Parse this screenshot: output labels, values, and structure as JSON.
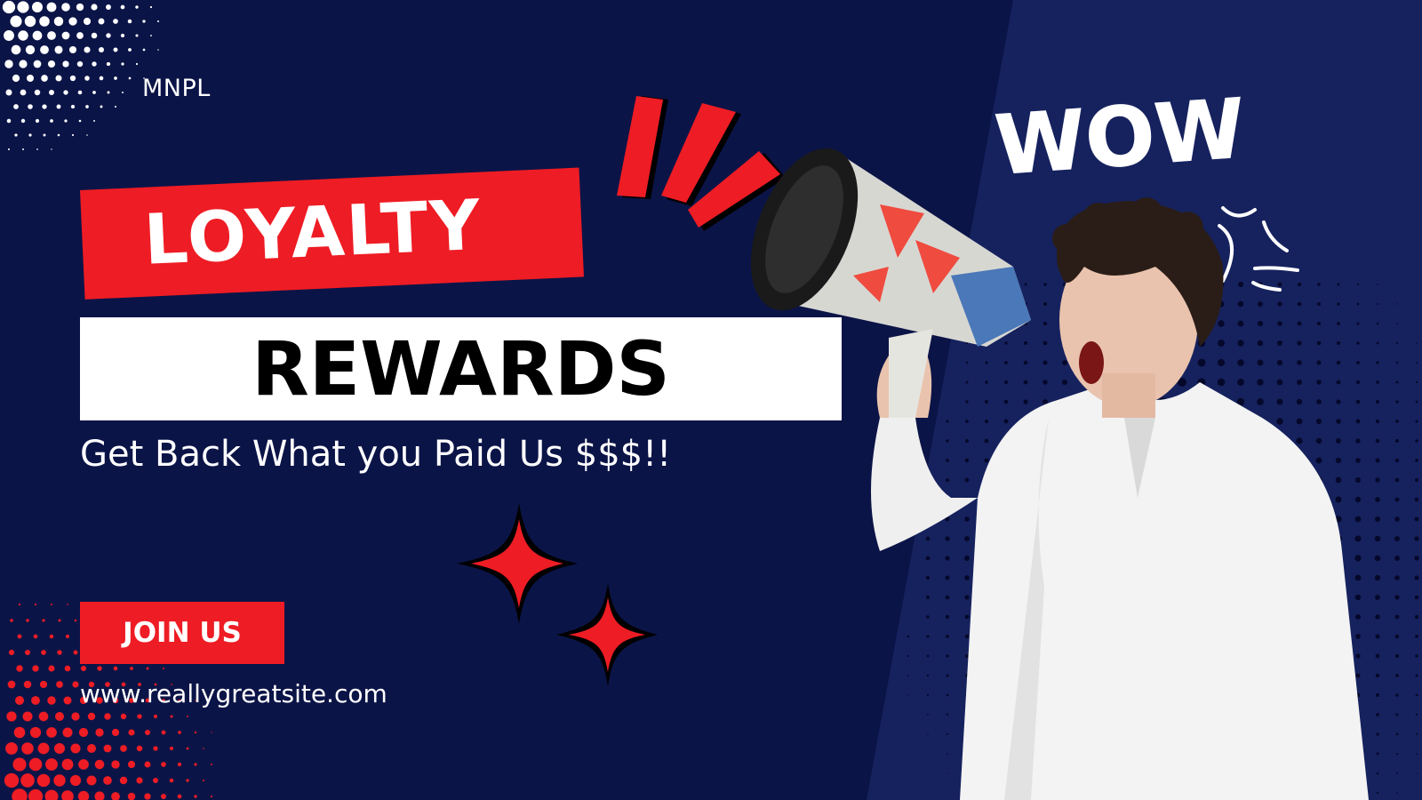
{
  "brand": {
    "name": "MNPL"
  },
  "headline": {
    "line1": "LOYALTY",
    "line2": "REWARDS"
  },
  "tagline": "Get Back What you Paid Us $$$!!",
  "cta": {
    "label": "JOIN US"
  },
  "website": "www.reallygreatsite.com",
  "sticker": {
    "text": "WOW"
  },
  "colors": {
    "background": "#0b1447",
    "panel": "#16225e",
    "accent": "#ee1c24",
    "white": "#ffffff",
    "black": "#000000"
  },
  "icons": [
    "sparkle-star-icon",
    "burst-lines-icon",
    "exclamation-burst-icon",
    "halftone-dots"
  ]
}
